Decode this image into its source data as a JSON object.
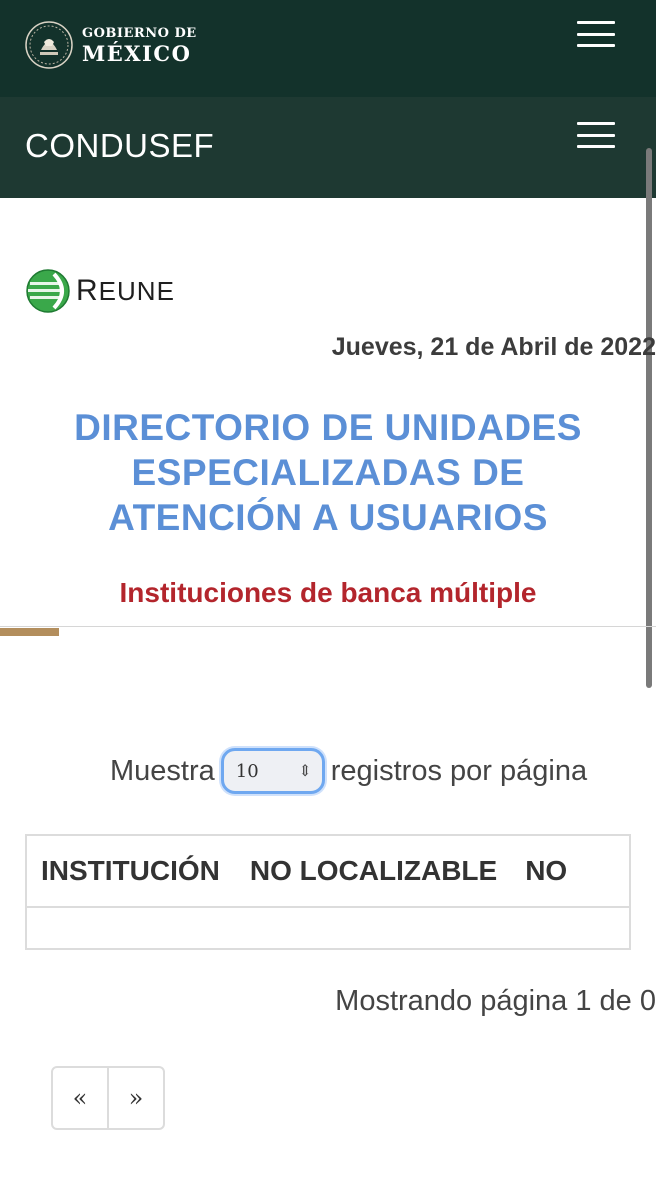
{
  "gov_header": {
    "line1": "GOBIERNO DE",
    "line2": "MÉXICO",
    "menu_icon": "hamburger-menu-icon"
  },
  "site_header": {
    "title": "CONDUSEF",
    "menu_icon": "hamburger-menu-icon"
  },
  "logo": {
    "first_letter": "R",
    "rest": "EUNE"
  },
  "date": "Jueves, 21 de Abril de 2022",
  "main_title": {
    "line1": "DIRECTORIO DE UNIDADES",
    "line2": "ESPECIALIZADAS DE",
    "line3": "ATENCIÓN A USUARIOS"
  },
  "subtitle": "Instituciones de banca múltiple",
  "length_control": {
    "prefix": "Muestra",
    "selected": "10",
    "suffix": "registros por página"
  },
  "table": {
    "columns": [
      "INSTITUCIÓN",
      "NO LOCALIZABLE",
      "NO"
    ]
  },
  "info": "Mostrando página 1 de 0",
  "pagination": {
    "prev": "«",
    "next": "»"
  },
  "colors": {
    "gov_bar": "#13322b",
    "site_bar": "#1e3932",
    "title_blue": "#5b8fd6",
    "subtitle_red": "#b3252c",
    "accent_gold": "#b38e5d"
  }
}
